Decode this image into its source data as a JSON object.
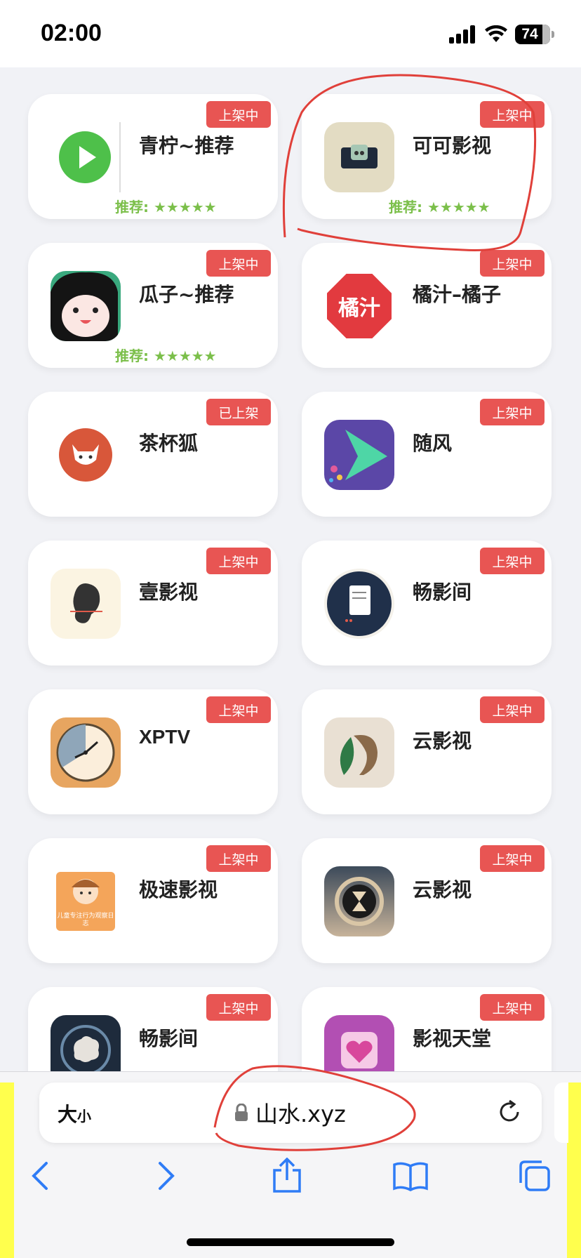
{
  "status": {
    "time": "02:00",
    "battery": "74"
  },
  "cards": [
    {
      "name": "青柠~推荐",
      "badge": "上架中",
      "rec": "推荐: ★★★★★",
      "icon": "play-icon"
    },
    {
      "name": "可可影视",
      "badge": "上架中",
      "rec": "推荐: ★★★★★",
      "icon": "tv-icon"
    },
    {
      "name": "瓜子~推荐",
      "badge": "上架中",
      "rec": "推荐: ★★★★★",
      "icon": "face-icon"
    },
    {
      "name": "橘汁–橘子",
      "badge": "上架中",
      "rec": "",
      "icon": "juice-logo-icon",
      "icon_text": "橘汁"
    },
    {
      "name": "茶杯狐",
      "badge": "已上架",
      "rec": "",
      "icon": "fox-icon"
    },
    {
      "name": "随风",
      "badge": "上架中",
      "rec": "",
      "icon": "play-arrow-icon"
    },
    {
      "name": "壹影视",
      "badge": "上架中",
      "rec": "",
      "icon": "ear-icon"
    },
    {
      "name": "畅影间",
      "badge": "上架中",
      "rec": "",
      "icon": "document-icon"
    },
    {
      "name": "XPTV",
      "badge": "上架中",
      "rec": "",
      "icon": "clock-icon"
    },
    {
      "name": "云影视",
      "badge": "上架中",
      "rec": "",
      "icon": "leaf-lion-icon"
    },
    {
      "name": "极速影视",
      "badge": "上架中",
      "rec": "",
      "icon": "reading-child-icon",
      "icon_text": "儿童专注行为观察日志"
    },
    {
      "name": "云影视",
      "badge": "上架中",
      "rec": "",
      "icon": "hourglass-icon"
    },
    {
      "name": "畅影间",
      "badge": "上架中",
      "rec": "",
      "icon": "brain-icon"
    },
    {
      "name": "影视天堂",
      "badge": "上架中",
      "rec": "",
      "icon": "heart-icon"
    }
  ],
  "browser": {
    "text_size_label": "大",
    "text_size_small": "小",
    "url": "山水.xyz"
  }
}
